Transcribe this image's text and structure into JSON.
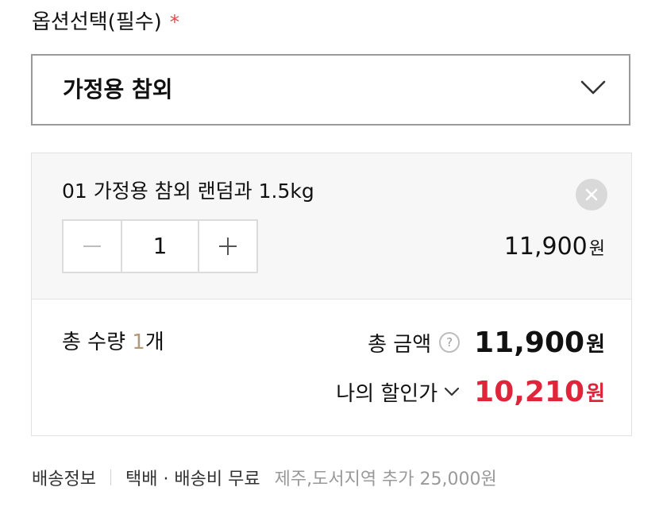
{
  "option": {
    "label": "옵션선택(필수)",
    "required_mark": "*",
    "selected_value": "가정용 참외"
  },
  "item": {
    "name": "01 가정용 참외 랜덤과 1.5kg",
    "quantity": "1",
    "price": "11,900",
    "currency": "원"
  },
  "summary": {
    "total_qty_label": "총 수량 ",
    "total_qty_value": "1",
    "total_qty_unit": "개",
    "total_amount_label": "총 금액",
    "help_glyph": "?",
    "total_amount": "11,900",
    "currency": "원",
    "discount_label": "나의 할인가",
    "discount_amount": "10,210"
  },
  "shipping": {
    "title": "배송정보",
    "info": "택배 · 배송비 무료",
    "extra": "제주,도서지역 추가 25,000원"
  },
  "icons": {
    "select": "chevron-down-icon",
    "remove": "close-icon",
    "decrease": "minus-icon",
    "increase": "plus-icon",
    "help": "help-icon",
    "discount_toggle": "chevron-down-icon"
  },
  "colors": {
    "required": "#e5484d",
    "discount": "#e0243a",
    "quantity_highlight": "#b29a77",
    "panel_bg": "#f7f7f7"
  }
}
